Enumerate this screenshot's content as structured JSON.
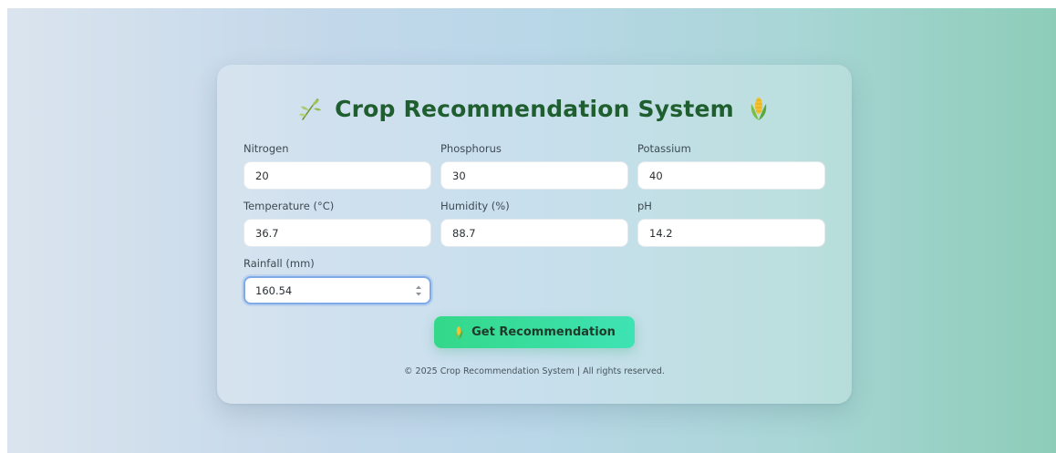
{
  "header": {
    "title": "Crop Recommendation System",
    "left_icon": "leaf-icon",
    "right_icon": "corn-icon"
  },
  "form": {
    "nitrogen": {
      "label": "Nitrogen",
      "value": "20"
    },
    "phosphorus": {
      "label": "Phosphorus",
      "value": "30"
    },
    "potassium": {
      "label": "Potassium",
      "value": "40"
    },
    "temperature": {
      "label": "Temperature (°C)",
      "value": "36.7"
    },
    "humidity": {
      "label": "Humidity (%)",
      "value": "88.7"
    },
    "ph": {
      "label": "pH",
      "value": "14.2"
    },
    "rainfall": {
      "label": "Rainfall (mm)",
      "value": "160.54"
    }
  },
  "submit": {
    "label": "Get Recommendation",
    "icon": "corn-icon"
  },
  "footer": {
    "text": "© 2025 Crop Recommendation System | All rights reserved."
  },
  "colors": {
    "title": "#1f5e2e",
    "button_start": "#34d889",
    "button_end": "#3ee3b4",
    "focus_ring": "#7fa9e8",
    "background_left": "#dbe4ee",
    "background_right": "#8dcdb8"
  }
}
